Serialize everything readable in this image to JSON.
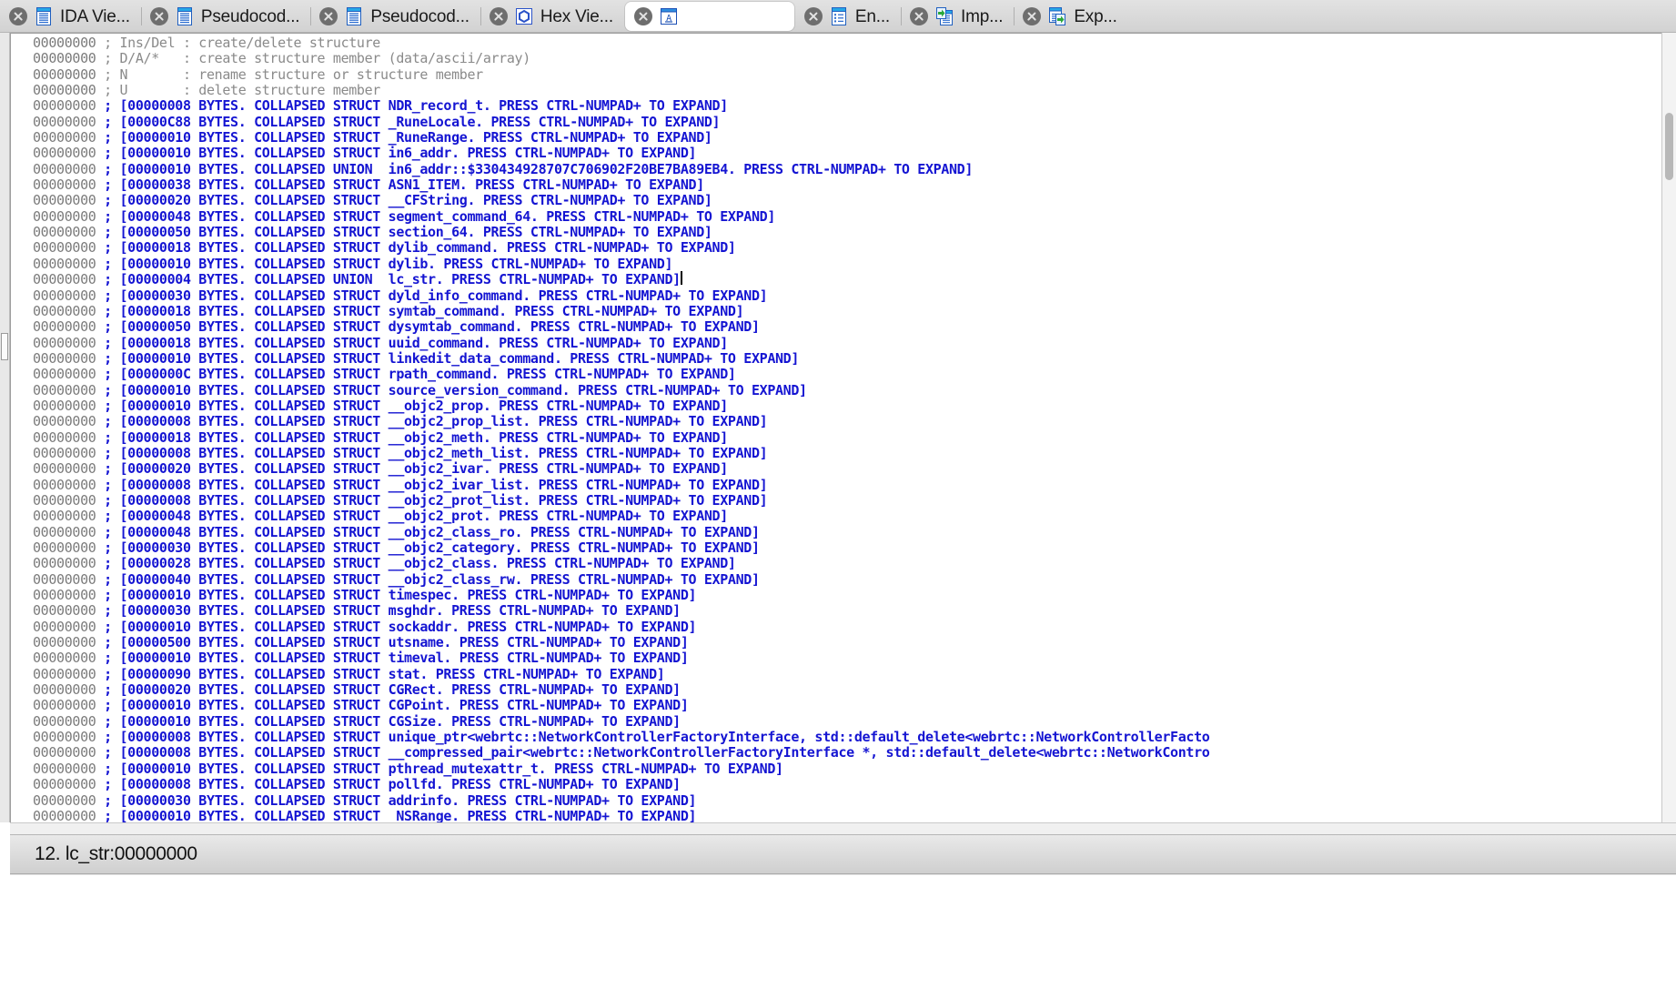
{
  "window": {
    "app": "IDA Pro",
    "active_view": "Structures"
  },
  "tabs": [
    {
      "label": "IDA Vie...",
      "icon": "document-listing-icon",
      "active": false,
      "closable": true
    },
    {
      "label": "Pseudocod...",
      "icon": "document-listing-icon",
      "active": false,
      "closable": true
    },
    {
      "label": "Pseudocod...",
      "icon": "document-listing-icon",
      "active": false,
      "closable": true
    },
    {
      "label": "Hex Vie...",
      "icon": "hex-view-icon",
      "active": false,
      "closable": true
    },
    {
      "label": "",
      "icon": "structures-icon",
      "active": true,
      "closable": true
    },
    {
      "label": "En...",
      "icon": "enums-icon",
      "active": false,
      "closable": true
    },
    {
      "label": "Imp...",
      "icon": "imports-icon",
      "active": false,
      "closable": true
    },
    {
      "label": "Exp...",
      "icon": "exports-icon",
      "active": false,
      "closable": true
    }
  ],
  "colors": {
    "code_blue": "#1414d2",
    "comment_gray": "#8a8a8a",
    "address_gray": "#7b7b7b",
    "tab_bar_bg": "#d7d7d7",
    "active_tab_bg": "#ffffff",
    "statusbar_bg": "#cfcfcf"
  },
  "code": {
    "address": "00000000",
    "lines": [
      {
        "kind": "comment",
        "address": "00000000",
        "text": "; Ins/Del : create/delete structure"
      },
      {
        "kind": "comment",
        "address": "00000000",
        "text": "; D/A/*   : create structure member (data/ascii/array)"
      },
      {
        "kind": "comment",
        "address": "00000000",
        "text": "; N       : rename structure or structure member"
      },
      {
        "kind": "comment",
        "address": "00000000",
        "text": "; U       : delete structure member"
      },
      {
        "kind": "struct",
        "address": "00000000",
        "text": "; [00000008 BYTES. COLLAPSED STRUCT NDR_record_t. PRESS CTRL-NUMPAD+ TO EXPAND]"
      },
      {
        "kind": "struct",
        "address": "00000000",
        "text": "; [00000C88 BYTES. COLLAPSED STRUCT _RuneLocale. PRESS CTRL-NUMPAD+ TO EXPAND]"
      },
      {
        "kind": "struct",
        "address": "00000000",
        "text": "; [00000010 BYTES. COLLAPSED STRUCT _RuneRange. PRESS CTRL-NUMPAD+ TO EXPAND]"
      },
      {
        "kind": "struct",
        "address": "00000000",
        "text": "; [00000010 BYTES. COLLAPSED STRUCT in6_addr. PRESS CTRL-NUMPAD+ TO EXPAND]"
      },
      {
        "kind": "struct",
        "address": "00000000",
        "text": "; [00000010 BYTES. COLLAPSED UNION  in6_addr::$330434928707C706902F20BE7BA89EB4. PRESS CTRL-NUMPAD+ TO EXPAND]"
      },
      {
        "kind": "struct",
        "address": "00000000",
        "text": "; [00000038 BYTES. COLLAPSED STRUCT ASN1_ITEM. PRESS CTRL-NUMPAD+ TO EXPAND]"
      },
      {
        "kind": "struct",
        "address": "00000000",
        "text": "; [00000020 BYTES. COLLAPSED STRUCT __CFString. PRESS CTRL-NUMPAD+ TO EXPAND]"
      },
      {
        "kind": "struct",
        "address": "00000000",
        "text": "; [00000048 BYTES. COLLAPSED STRUCT segment_command_64. PRESS CTRL-NUMPAD+ TO EXPAND]"
      },
      {
        "kind": "struct",
        "address": "00000000",
        "text": "; [00000050 BYTES. COLLAPSED STRUCT section_64. PRESS CTRL-NUMPAD+ TO EXPAND]"
      },
      {
        "kind": "struct",
        "address": "00000000",
        "text": "; [00000018 BYTES. COLLAPSED STRUCT dylib_command. PRESS CTRL-NUMPAD+ TO EXPAND]"
      },
      {
        "kind": "struct",
        "address": "00000000",
        "text": "; [00000010 BYTES. COLLAPSED STRUCT dylib. PRESS CTRL-NUMPAD+ TO EXPAND]"
      },
      {
        "kind": "struct",
        "address": "00000000",
        "text": "; [00000004 BYTES. COLLAPSED UNION  lc_str. PRESS CTRL-NUMPAD+ TO EXPAND]",
        "cursor": true
      },
      {
        "kind": "struct",
        "address": "00000000",
        "text": "; [00000030 BYTES. COLLAPSED STRUCT dyld_info_command. PRESS CTRL-NUMPAD+ TO EXPAND]"
      },
      {
        "kind": "struct",
        "address": "00000000",
        "text": "; [00000018 BYTES. COLLAPSED STRUCT symtab_command. PRESS CTRL-NUMPAD+ TO EXPAND]"
      },
      {
        "kind": "struct",
        "address": "00000000",
        "text": "; [00000050 BYTES. COLLAPSED STRUCT dysymtab_command. PRESS CTRL-NUMPAD+ TO EXPAND]"
      },
      {
        "kind": "struct",
        "address": "00000000",
        "text": "; [00000018 BYTES. COLLAPSED STRUCT uuid_command. PRESS CTRL-NUMPAD+ TO EXPAND]"
      },
      {
        "kind": "struct",
        "address": "00000000",
        "text": "; [00000010 BYTES. COLLAPSED STRUCT linkedit_data_command. PRESS CTRL-NUMPAD+ TO EXPAND]"
      },
      {
        "kind": "struct",
        "address": "00000000",
        "text": "; [0000000C BYTES. COLLAPSED STRUCT rpath_command. PRESS CTRL-NUMPAD+ TO EXPAND]"
      },
      {
        "kind": "struct",
        "address": "00000000",
        "text": "; [00000010 BYTES. COLLAPSED STRUCT source_version_command. PRESS CTRL-NUMPAD+ TO EXPAND]"
      },
      {
        "kind": "struct",
        "address": "00000000",
        "text": "; [00000010 BYTES. COLLAPSED STRUCT __objc2_prop. PRESS CTRL-NUMPAD+ TO EXPAND]"
      },
      {
        "kind": "struct",
        "address": "00000000",
        "text": "; [00000008 BYTES. COLLAPSED STRUCT __objc2_prop_list. PRESS CTRL-NUMPAD+ TO EXPAND]"
      },
      {
        "kind": "struct",
        "address": "00000000",
        "text": "; [00000018 BYTES. COLLAPSED STRUCT __objc2_meth. PRESS CTRL-NUMPAD+ TO EXPAND]"
      },
      {
        "kind": "struct",
        "address": "00000000",
        "text": "; [00000008 BYTES. COLLAPSED STRUCT __objc2_meth_list. PRESS CTRL-NUMPAD+ TO EXPAND]"
      },
      {
        "kind": "struct",
        "address": "00000000",
        "text": "; [00000020 BYTES. COLLAPSED STRUCT __objc2_ivar. PRESS CTRL-NUMPAD+ TO EXPAND]"
      },
      {
        "kind": "struct",
        "address": "00000000",
        "text": "; [00000008 BYTES. COLLAPSED STRUCT __objc2_ivar_list. PRESS CTRL-NUMPAD+ TO EXPAND]"
      },
      {
        "kind": "struct",
        "address": "00000000",
        "text": "; [00000008 BYTES. COLLAPSED STRUCT __objc2_prot_list. PRESS CTRL-NUMPAD+ TO EXPAND]"
      },
      {
        "kind": "struct",
        "address": "00000000",
        "text": "; [00000048 BYTES. COLLAPSED STRUCT __objc2_prot. PRESS CTRL-NUMPAD+ TO EXPAND]"
      },
      {
        "kind": "struct",
        "address": "00000000",
        "text": "; [00000048 BYTES. COLLAPSED STRUCT __objc2_class_ro. PRESS CTRL-NUMPAD+ TO EXPAND]"
      },
      {
        "kind": "struct",
        "address": "00000000",
        "text": "; [00000030 BYTES. COLLAPSED STRUCT __objc2_category. PRESS CTRL-NUMPAD+ TO EXPAND]"
      },
      {
        "kind": "struct",
        "address": "00000000",
        "text": "; [00000028 BYTES. COLLAPSED STRUCT __objc2_class. PRESS CTRL-NUMPAD+ TO EXPAND]"
      },
      {
        "kind": "struct",
        "address": "00000000",
        "text": "; [00000040 BYTES. COLLAPSED STRUCT __objc2_class_rw. PRESS CTRL-NUMPAD+ TO EXPAND]"
      },
      {
        "kind": "struct",
        "address": "00000000",
        "text": "; [00000010 BYTES. COLLAPSED STRUCT timespec. PRESS CTRL-NUMPAD+ TO EXPAND]"
      },
      {
        "kind": "struct",
        "address": "00000000",
        "text": "; [00000030 BYTES. COLLAPSED STRUCT msghdr. PRESS CTRL-NUMPAD+ TO EXPAND]"
      },
      {
        "kind": "struct",
        "address": "00000000",
        "text": "; [00000010 BYTES. COLLAPSED STRUCT sockaddr. PRESS CTRL-NUMPAD+ TO EXPAND]"
      },
      {
        "kind": "struct",
        "address": "00000000",
        "text": "; [00000500 BYTES. COLLAPSED STRUCT utsname. PRESS CTRL-NUMPAD+ TO EXPAND]"
      },
      {
        "kind": "struct",
        "address": "00000000",
        "text": "; [00000010 BYTES. COLLAPSED STRUCT timeval. PRESS CTRL-NUMPAD+ TO EXPAND]"
      },
      {
        "kind": "struct",
        "address": "00000000",
        "text": "; [00000090 BYTES. COLLAPSED STRUCT stat. PRESS CTRL-NUMPAD+ TO EXPAND]"
      },
      {
        "kind": "struct",
        "address": "00000000",
        "text": "; [00000020 BYTES. COLLAPSED STRUCT CGRect. PRESS CTRL-NUMPAD+ TO EXPAND]"
      },
      {
        "kind": "struct",
        "address": "00000000",
        "text": "; [00000010 BYTES. COLLAPSED STRUCT CGPoint. PRESS CTRL-NUMPAD+ TO EXPAND]"
      },
      {
        "kind": "struct",
        "address": "00000000",
        "text": "; [00000010 BYTES. COLLAPSED STRUCT CGSize. PRESS CTRL-NUMPAD+ TO EXPAND]"
      },
      {
        "kind": "struct",
        "address": "00000000",
        "text": "; [00000008 BYTES. COLLAPSED STRUCT unique_ptr<webrtc::NetworkControllerFactoryInterface, std::default_delete<webrtc::NetworkControllerFacto"
      },
      {
        "kind": "struct",
        "address": "00000000",
        "text": "; [00000008 BYTES. COLLAPSED STRUCT __compressed_pair<webrtc::NetworkControllerFactoryInterface *, std::default_delete<webrtc::NetworkContro"
      },
      {
        "kind": "struct",
        "address": "00000000",
        "text": "; [00000010 BYTES. COLLAPSED STRUCT pthread_mutexattr_t. PRESS CTRL-NUMPAD+ TO EXPAND]"
      },
      {
        "kind": "struct",
        "address": "00000000",
        "text": "; [00000008 BYTES. COLLAPSED STRUCT pollfd. PRESS CTRL-NUMPAD+ TO EXPAND]"
      },
      {
        "kind": "struct",
        "address": "00000000",
        "text": "; [00000030 BYTES. COLLAPSED STRUCT addrinfo. PRESS CTRL-NUMPAD+ TO EXPAND]"
      },
      {
        "kind": "struct",
        "address": "00000000",
        "text": "; [00000010 BYTES. COLLAPSED STRUCT _NSRange. PRESS CTRL-NUMPAD+ TO EXPAND]"
      }
    ]
  },
  "statusbar": {
    "text": "12. lc_str:00000000"
  }
}
